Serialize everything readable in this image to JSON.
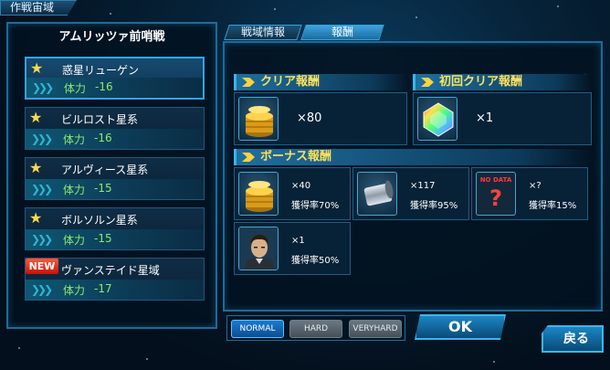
{
  "header": {
    "title": "作戦宙域"
  },
  "operation": {
    "title": "アムリッツァ前哨戦"
  },
  "stages": [
    {
      "name": "惑星リューゲン",
      "stamina_label": "体力",
      "stamina": "-16",
      "badge": "star",
      "selected": true
    },
    {
      "name": "ビルロスト星系",
      "stamina_label": "体力",
      "stamina": "-16",
      "badge": "star",
      "selected": false
    },
    {
      "name": "アルヴィース星系",
      "stamina_label": "体力",
      "stamina": "-15",
      "badge": "star",
      "selected": false
    },
    {
      "name": "ボルソルン星系",
      "stamina_label": "体力",
      "stamina": "-15",
      "badge": "star",
      "selected": false
    },
    {
      "name": "ヴァンステイド星域",
      "stamina_label": "体力",
      "stamina": "-17",
      "badge": "NEW",
      "selected": false
    }
  ],
  "tabs": {
    "info": "戦域情報",
    "reward": "報酬",
    "active": "reward"
  },
  "clear_reward": {
    "title": "クリア報酬",
    "item_icon": "gold-coins-icon",
    "qty": "×80"
  },
  "first_clear_reward": {
    "title": "初回クリア報酬",
    "item_icon": "rainbow-crystal-icon",
    "qty": "×1"
  },
  "bonus_reward": {
    "title": "ボーナス報酬",
    "items": [
      {
        "icon": "gold-coins-icon",
        "qty": "×40",
        "rate": "獲得率70%"
      },
      {
        "icon": "metal-cylinder-icon",
        "qty": "×117",
        "rate": "獲得率95%"
      },
      {
        "icon": "no-data-icon",
        "nodata_text": "NO DATA",
        "nodata_mark": "?",
        "qty": "×?",
        "rate": "獲得率15%"
      },
      {
        "icon": "officer-portrait-icon",
        "qty": "×1",
        "rate": "獲得率50%"
      }
    ]
  },
  "difficulty": {
    "options": [
      "NORMAL",
      "HARD",
      "VERYHARD"
    ],
    "selected": "NORMAL"
  },
  "buttons": {
    "ok": "OK",
    "back": "戻る"
  },
  "colors": {
    "accent": "#31a5e8",
    "gold_text": "#ffe25a",
    "stamina": "#8fe86e",
    "nodata": "#ff3a3a"
  }
}
